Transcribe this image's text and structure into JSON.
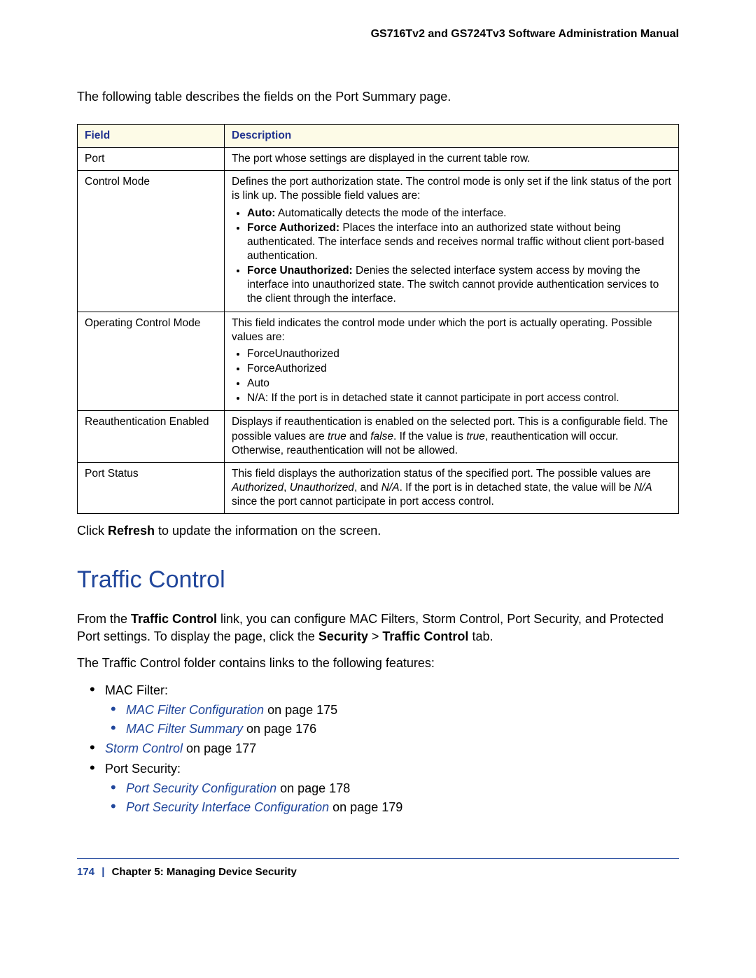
{
  "header": {
    "title": "GS716Tv2 and GS724Tv3 Software Administration Manual"
  },
  "intro": "The following table describes the fields on the Port Summary page.",
  "table": {
    "headers": {
      "field": "Field",
      "description": "Description"
    },
    "rows": {
      "port": {
        "field": "Port",
        "desc": "The port whose settings are displayed in the current table row."
      },
      "control_mode": {
        "field": "Control Mode",
        "desc_lead": "Defines the port authorization state. The control mode is only set if the link status of the port is link up. The possible field values are:",
        "b1_bold": "Auto:",
        "b1_rest": " Automatically detects the mode of the interface.",
        "b2_bold": "Force Authorized:",
        "b2_rest": " Places the interface into an authorized state without being authenticated. The interface sends and receives normal traffic without client port-based authentication.",
        "b3_bold": "Force Unauthorized:",
        "b3_rest": " Denies the selected interface system access by moving the interface into unauthorized state. The switch cannot provide authentication services to the client through the interface."
      },
      "operating": {
        "field": "Operating Control Mode",
        "desc_lead": "This field indicates the control mode under which the port is actually operating. Possible values are:",
        "b1": "ForceUnauthorized",
        "b2": "ForceAuthorized",
        "b3": "Auto",
        "b4": "N/A: If the port is in detached state it cannot participate in port access control."
      },
      "reauth": {
        "field": "Reauthentication Enabled",
        "desc_pre": "Displays if reauthentication is enabled on the selected port. This is a configurable field. The possible values are ",
        "true": "true",
        "and": " and ",
        "false": "false",
        "mid": ". If the value is ",
        "true2": "true",
        "post": ", reauthentication will occur. Otherwise, reauthentication will not be allowed."
      },
      "port_status": {
        "field": "Port Status",
        "desc_pre": "This field displays the authorization status of the specified port. The possible values are ",
        "v1": "Authorized",
        "c1": ", ",
        "v2": "Unauthorized",
        "c2": ", and ",
        "v3": "N/A",
        "mid": ". If the port is in detached state, the value will be ",
        "v4": "N/A",
        "post": " since the port cannot participate in port access control."
      }
    }
  },
  "after_table": {
    "pre": "Click ",
    "bold": "Refresh",
    "post": " to update the information on the screen."
  },
  "section": {
    "title": "Traffic Control",
    "p1_pre": "From the ",
    "p1_b1": "Traffic Control",
    "p1_mid": " link, you can configure MAC Filters, Storm Control, Port Security, and Protected Port settings. To display the page, click the ",
    "p1_b2": "Security",
    "p1_gt": " > ",
    "p1_b3": "Traffic Control",
    "p1_post": " tab.",
    "p2": "The Traffic Control folder contains links to the following features:"
  },
  "list": {
    "mac_filter": "MAC Filter:",
    "mac_filter_cfg": "MAC Filter Configuration",
    "mac_filter_cfg_pg": " on page 175",
    "mac_filter_sum": "MAC Filter Summary",
    "mac_filter_sum_pg": " on page 176",
    "storm": "Storm Control",
    "storm_pg": " on page 177",
    "port_security": "Port Security:",
    "psc": "Port Security Configuration",
    "psc_pg": " on page 178",
    "psic": "Port Security Interface Configuration",
    "psic_pg": " on page 179"
  },
  "footer": {
    "pagenum": "174",
    "sep": "|",
    "chapter": "Chapter 5:  Managing Device Security"
  }
}
